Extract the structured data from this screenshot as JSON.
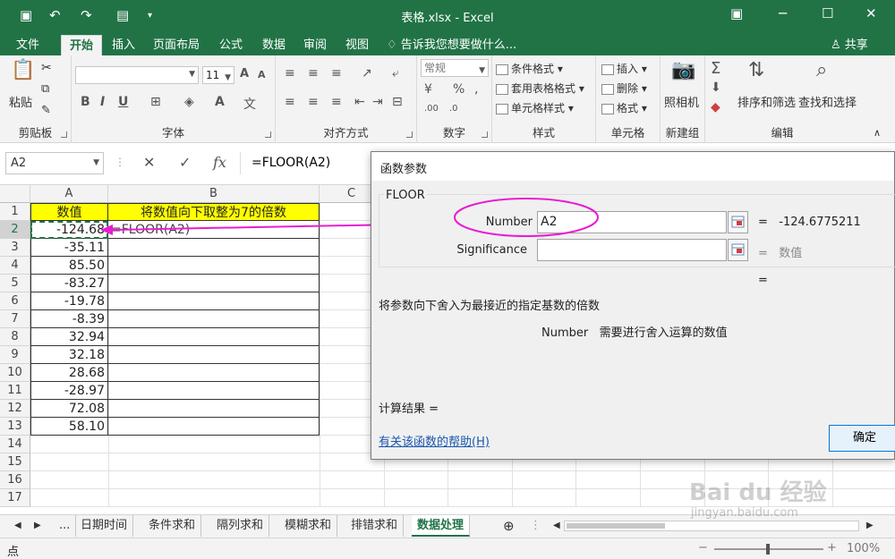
{
  "window": {
    "title": "表格.xlsx - Excel"
  },
  "ribbon_tabs": [
    "文件",
    "开始",
    "插入",
    "页面布局",
    "公式",
    "数据",
    "审阅",
    "视图"
  ],
  "tell_me": "告诉我您想要做什么...",
  "share": "共享",
  "ribbon": {
    "clipboard": {
      "paste": "粘贴",
      "label": "剪贴板"
    },
    "font": {
      "size": "11",
      "label": "字体",
      "bold": "B",
      "italic": "I",
      "underline": "U"
    },
    "alignment": {
      "label": "对齐方式"
    },
    "number": {
      "format": "常规",
      "label": "数字"
    },
    "styles": {
      "conditional": "条件格式",
      "table": "套用表格格式",
      "cell": "单元格样式",
      "label": "样式"
    },
    "cells": {
      "insert": "插入",
      "delete": "删除",
      "format": "格式",
      "label": "单元格"
    },
    "new_group": {
      "camera": "照相机",
      "label": "新建组"
    },
    "editing": {
      "sort": "排序和筛选",
      "find": "查找和选择",
      "label": "编辑"
    }
  },
  "formula_bar": {
    "name_box": "A2",
    "cancel": "✕",
    "enter": "✓",
    "fx": "fx",
    "formula": "=FLOOR(A2)"
  },
  "columns": [
    "A",
    "B",
    "C"
  ],
  "rows": [
    "1",
    "2",
    "3",
    "4",
    "5",
    "6",
    "7",
    "8",
    "9",
    "10",
    "11",
    "12",
    "13",
    "14",
    "15",
    "16",
    "17"
  ],
  "cells": {
    "A1": "数值",
    "B1": "将数值向下取整为7的倍数",
    "B2": "=FLOOR(A2)",
    "values": [
      "-124.68",
      "-35.11",
      "85.50",
      "-83.27",
      "-19.78",
      "-8.39",
      "32.94",
      "32.18",
      "28.68",
      "-28.97",
      "72.08",
      "58.10"
    ]
  },
  "sheet_tabs": [
    "...",
    "日期时间",
    "条件求和",
    "隔列求和",
    "模糊求和",
    "排错求和",
    "数据处理"
  ],
  "active_sheet": "数据处理",
  "status": {
    "mode": "点",
    "zoom": "100%"
  },
  "dialog": {
    "title": "函数参数",
    "function_name": "FLOOR",
    "args": [
      {
        "label": "Number",
        "value": "A2",
        "result": "-124.6775211"
      },
      {
        "label": "Significance",
        "value": "",
        "result": "数值"
      }
    ],
    "extra_result": "=",
    "description": "将参数向下舍入为最接近的指定基数的倍数",
    "arg_name": "Number",
    "arg_description": "需要进行舍入运算的数值",
    "calc_result": "计算结果 =",
    "help_link": "有关该函数的帮助(H)",
    "ok": "确定"
  },
  "colors": {
    "excel_green": "#217346",
    "header_yellow": "#ffff00",
    "annotation": "#e81dd1",
    "link": "#1b56b0"
  },
  "watermark": "Baidu经验 jingyan.baidu.com"
}
